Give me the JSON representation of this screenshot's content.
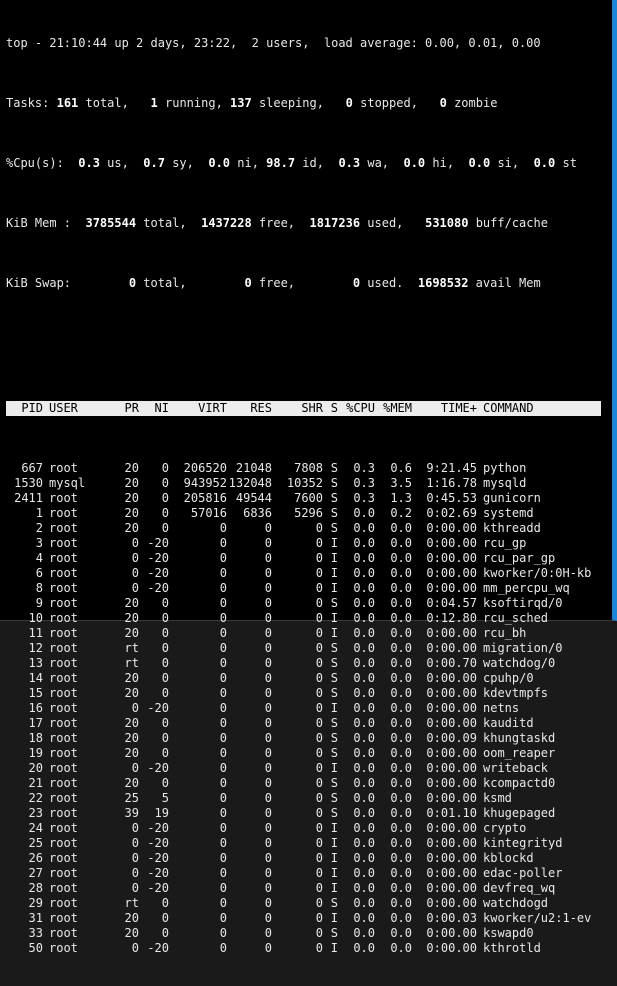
{
  "summary": {
    "line1": {
      "prefix": "top - 21:10:44 up 2 days, 23:22,  2 users,  load average: 0.00, 0.01, 0.00"
    },
    "tasks": {
      "label": "Tasks:",
      "total": "161",
      "total_label": " total,",
      "running": "1",
      "running_label": " running,",
      "sleeping": "137",
      "sleeping_label": " sleeping,",
      "stopped": "0",
      "stopped_label": " stopped,",
      "zombie": "0",
      "zombie_label": " zombie"
    },
    "cpu": {
      "label": "%Cpu(s):",
      "us": "0.3",
      "us_label": " us,",
      "sy": "0.7",
      "sy_label": " sy,",
      "ni": "0.0",
      "ni_label": " ni,",
      "id": "98.7",
      "id_label": " id,",
      "wa": "0.3",
      "wa_label": " wa,",
      "hi": "0.0",
      "hi_label": " hi,",
      "si": "0.0",
      "si_label": " si,",
      "st": "0.0",
      "st_label": " st"
    },
    "mem": {
      "label": "KiB Mem :",
      "total": "3785544",
      "total_label": " total,",
      "free": "1437228",
      "free_label": " free,",
      "used": "1817236",
      "used_label": " used,",
      "buff": "531080",
      "buff_label": " buff/cache"
    },
    "swap": {
      "label": "KiB Swap:",
      "total": "0",
      "total_label": " total,",
      "free": "0",
      "free_label": " free,",
      "used": "0",
      "used_label": " used.",
      "avail": "1698532",
      "avail_label": " avail Mem"
    }
  },
  "columns": {
    "pid": "PID",
    "user": "USER",
    "pr": "PR",
    "ni": "NI",
    "virt": "VIRT",
    "res": "RES",
    "shr": "SHR",
    "s": "S",
    "cpu": "%CPU",
    "mem": "%MEM",
    "time": "TIME+",
    "command": "COMMAND"
  },
  "processes": [
    {
      "pid": "667",
      "user": "root",
      "pr": "20",
      "ni": "0",
      "virt": "206520",
      "res": "21048",
      "shr": "7808",
      "s": "S",
      "cpu": "0.3",
      "mem": "0.6",
      "time": "9:21.45",
      "command": "python"
    },
    {
      "pid": "1530",
      "user": "mysql",
      "pr": "20",
      "ni": "0",
      "virt": "943952",
      "res": "132048",
      "shr": "10352",
      "s": "S",
      "cpu": "0.3",
      "mem": "3.5",
      "time": "1:16.78",
      "command": "mysqld"
    },
    {
      "pid": "2411",
      "user": "root",
      "pr": "20",
      "ni": "0",
      "virt": "205816",
      "res": "49544",
      "shr": "7600",
      "s": "S",
      "cpu": "0.3",
      "mem": "1.3",
      "time": "0:45.53",
      "command": "gunicorn"
    },
    {
      "pid": "1",
      "user": "root",
      "pr": "20",
      "ni": "0",
      "virt": "57016",
      "res": "6836",
      "shr": "5296",
      "s": "S",
      "cpu": "0.0",
      "mem": "0.2",
      "time": "0:02.69",
      "command": "systemd"
    },
    {
      "pid": "2",
      "user": "root",
      "pr": "20",
      "ni": "0",
      "virt": "0",
      "res": "0",
      "shr": "0",
      "s": "S",
      "cpu": "0.0",
      "mem": "0.0",
      "time": "0:00.00",
      "command": "kthreadd"
    },
    {
      "pid": "3",
      "user": "root",
      "pr": "0",
      "ni": "-20",
      "virt": "0",
      "res": "0",
      "shr": "0",
      "s": "I",
      "cpu": "0.0",
      "mem": "0.0",
      "time": "0:00.00",
      "command": "rcu_gp"
    },
    {
      "pid": "4",
      "user": "root",
      "pr": "0",
      "ni": "-20",
      "virt": "0",
      "res": "0",
      "shr": "0",
      "s": "I",
      "cpu": "0.0",
      "mem": "0.0",
      "time": "0:00.00",
      "command": "rcu_par_gp"
    },
    {
      "pid": "6",
      "user": "root",
      "pr": "0",
      "ni": "-20",
      "virt": "0",
      "res": "0",
      "shr": "0",
      "s": "I",
      "cpu": "0.0",
      "mem": "0.0",
      "time": "0:00.00",
      "command": "kworker/0:0H-kb"
    },
    {
      "pid": "8",
      "user": "root",
      "pr": "0",
      "ni": "-20",
      "virt": "0",
      "res": "0",
      "shr": "0",
      "s": "I",
      "cpu": "0.0",
      "mem": "0.0",
      "time": "0:00.00",
      "command": "mm_percpu_wq"
    },
    {
      "pid": "9",
      "user": "root",
      "pr": "20",
      "ni": "0",
      "virt": "0",
      "res": "0",
      "shr": "0",
      "s": "S",
      "cpu": "0.0",
      "mem": "0.0",
      "time": "0:04.57",
      "command": "ksoftirqd/0"
    },
    {
      "pid": "10",
      "user": "root",
      "pr": "20",
      "ni": "0",
      "virt": "0",
      "res": "0",
      "shr": "0",
      "s": "I",
      "cpu": "0.0",
      "mem": "0.0",
      "time": "0:12.80",
      "command": "rcu_sched"
    },
    {
      "pid": "11",
      "user": "root",
      "pr": "20",
      "ni": "0",
      "virt": "0",
      "res": "0",
      "shr": "0",
      "s": "I",
      "cpu": "0.0",
      "mem": "0.0",
      "time": "0:00.00",
      "command": "rcu_bh"
    },
    {
      "pid": "12",
      "user": "root",
      "pr": "rt",
      "ni": "0",
      "virt": "0",
      "res": "0",
      "shr": "0",
      "s": "S",
      "cpu": "0.0",
      "mem": "0.0",
      "time": "0:00.00",
      "command": "migration/0"
    },
    {
      "pid": "13",
      "user": "root",
      "pr": "rt",
      "ni": "0",
      "virt": "0",
      "res": "0",
      "shr": "0",
      "s": "S",
      "cpu": "0.0",
      "mem": "0.0",
      "time": "0:00.70",
      "command": "watchdog/0"
    },
    {
      "pid": "14",
      "user": "root",
      "pr": "20",
      "ni": "0",
      "virt": "0",
      "res": "0",
      "shr": "0",
      "s": "S",
      "cpu": "0.0",
      "mem": "0.0",
      "time": "0:00.00",
      "command": "cpuhp/0"
    },
    {
      "pid": "15",
      "user": "root",
      "pr": "20",
      "ni": "0",
      "virt": "0",
      "res": "0",
      "shr": "0",
      "s": "S",
      "cpu": "0.0",
      "mem": "0.0",
      "time": "0:00.00",
      "command": "kdevtmpfs"
    },
    {
      "pid": "16",
      "user": "root",
      "pr": "0",
      "ni": "-20",
      "virt": "0",
      "res": "0",
      "shr": "0",
      "s": "I",
      "cpu": "0.0",
      "mem": "0.0",
      "time": "0:00.00",
      "command": "netns"
    },
    {
      "pid": "17",
      "user": "root",
      "pr": "20",
      "ni": "0",
      "virt": "0",
      "res": "0",
      "shr": "0",
      "s": "S",
      "cpu": "0.0",
      "mem": "0.0",
      "time": "0:00.00",
      "command": "kauditd"
    },
    {
      "pid": "18",
      "user": "root",
      "pr": "20",
      "ni": "0",
      "virt": "0",
      "res": "0",
      "shr": "0",
      "s": "S",
      "cpu": "0.0",
      "mem": "0.0",
      "time": "0:00.09",
      "command": "khungtaskd"
    },
    {
      "pid": "19",
      "user": "root",
      "pr": "20",
      "ni": "0",
      "virt": "0",
      "res": "0",
      "shr": "0",
      "s": "S",
      "cpu": "0.0",
      "mem": "0.0",
      "time": "0:00.00",
      "command": "oom_reaper"
    },
    {
      "pid": "20",
      "user": "root",
      "pr": "0",
      "ni": "-20",
      "virt": "0",
      "res": "0",
      "shr": "0",
      "s": "I",
      "cpu": "0.0",
      "mem": "0.0",
      "time": "0:00.00",
      "command": "writeback"
    },
    {
      "pid": "21",
      "user": "root",
      "pr": "20",
      "ni": "0",
      "virt": "0",
      "res": "0",
      "shr": "0",
      "s": "S",
      "cpu": "0.0",
      "mem": "0.0",
      "time": "0:00.00",
      "command": "kcompactd0"
    },
    {
      "pid": "22",
      "user": "root",
      "pr": "25",
      "ni": "5",
      "virt": "0",
      "res": "0",
      "shr": "0",
      "s": "S",
      "cpu": "0.0",
      "mem": "0.0",
      "time": "0:00.00",
      "command": "ksmd"
    },
    {
      "pid": "23",
      "user": "root",
      "pr": "39",
      "ni": "19",
      "virt": "0",
      "res": "0",
      "shr": "0",
      "s": "S",
      "cpu": "0.0",
      "mem": "0.0",
      "time": "0:01.10",
      "command": "khugepaged"
    },
    {
      "pid": "24",
      "user": "root",
      "pr": "0",
      "ni": "-20",
      "virt": "0",
      "res": "0",
      "shr": "0",
      "s": "I",
      "cpu": "0.0",
      "mem": "0.0",
      "time": "0:00.00",
      "command": "crypto"
    },
    {
      "pid": "25",
      "user": "root",
      "pr": "0",
      "ni": "-20",
      "virt": "0",
      "res": "0",
      "shr": "0",
      "s": "I",
      "cpu": "0.0",
      "mem": "0.0",
      "time": "0:00.00",
      "command": "kintegrityd"
    },
    {
      "pid": "26",
      "user": "root",
      "pr": "0",
      "ni": "-20",
      "virt": "0",
      "res": "0",
      "shr": "0",
      "s": "I",
      "cpu": "0.0",
      "mem": "0.0",
      "time": "0:00.00",
      "command": "kblockd"
    },
    {
      "pid": "27",
      "user": "root",
      "pr": "0",
      "ni": "-20",
      "virt": "0",
      "res": "0",
      "shr": "0",
      "s": "I",
      "cpu": "0.0",
      "mem": "0.0",
      "time": "0:00.00",
      "command": "edac-poller"
    },
    {
      "pid": "28",
      "user": "root",
      "pr": "0",
      "ni": "-20",
      "virt": "0",
      "res": "0",
      "shr": "0",
      "s": "I",
      "cpu": "0.0",
      "mem": "0.0",
      "time": "0:00.00",
      "command": "devfreq_wq"
    },
    {
      "pid": "29",
      "user": "root",
      "pr": "rt",
      "ni": "0",
      "virt": "0",
      "res": "0",
      "shr": "0",
      "s": "S",
      "cpu": "0.0",
      "mem": "0.0",
      "time": "0:00.00",
      "command": "watchdogd"
    },
    {
      "pid": "31",
      "user": "root",
      "pr": "20",
      "ni": "0",
      "virt": "0",
      "res": "0",
      "shr": "0",
      "s": "I",
      "cpu": "0.0",
      "mem": "0.0",
      "time": "0:00.03",
      "command": "kworker/u2:1-ev"
    },
    {
      "pid": "33",
      "user": "root",
      "pr": "20",
      "ni": "0",
      "virt": "0",
      "res": "0",
      "shr": "0",
      "s": "S",
      "cpu": "0.0",
      "mem": "0.0",
      "time": "0:00.00",
      "command": "kswapd0"
    },
    {
      "pid": "50",
      "user": "root",
      "pr": "0",
      "ni": "-20",
      "virt": "0",
      "res": "0",
      "shr": "0",
      "s": "I",
      "cpu": "0.0",
      "mem": "0.0",
      "time": "0:00.00",
      "command": "kthrotld"
    }
  ],
  "colors": {
    "background": "#000000",
    "text": "#e8e8e8",
    "header_bg": "#ececec",
    "header_text": "#000000",
    "window_border": "#1b86d6"
  }
}
